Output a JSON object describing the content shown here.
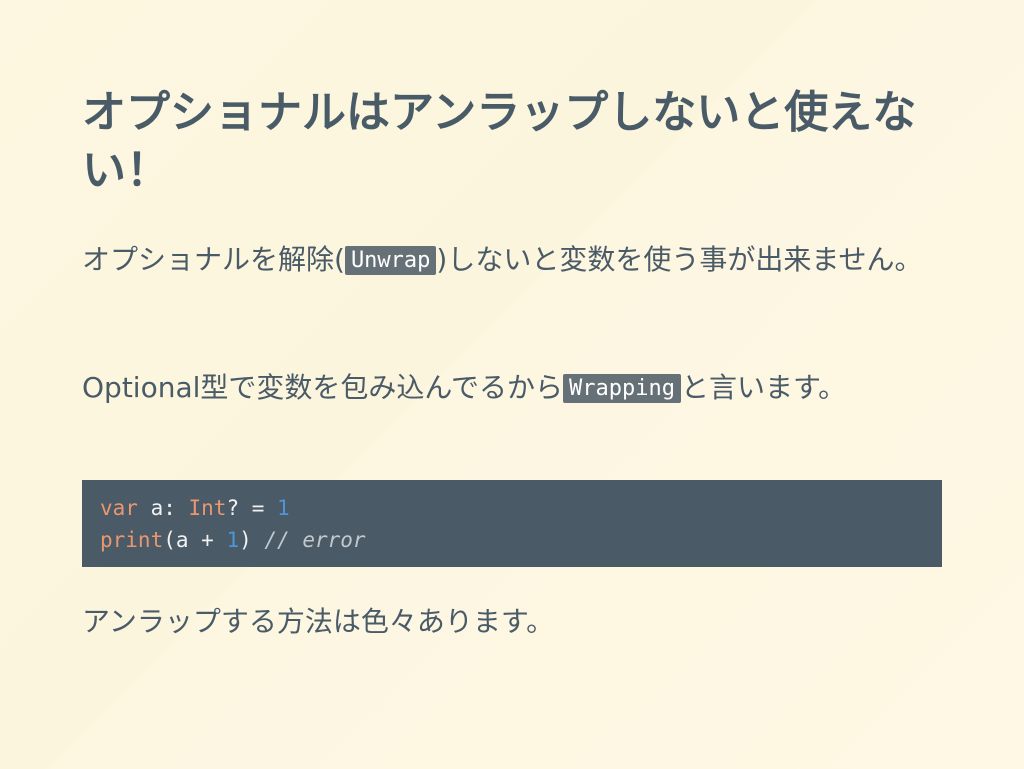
{
  "slide": {
    "title": "オプショナルはアンラップしないと使えない！",
    "paragraph1": {
      "before": "オプショナルを解除(",
      "code": "Unwrap",
      "after": ")しないと変数を使う事が出来ません。"
    },
    "paragraph2": {
      "before": "Optional型で変数を包み込んでるから",
      "code": "Wrapping",
      "after": "と言います。"
    },
    "code_block": {
      "line1": {
        "kw": "var",
        "name": " a: ",
        "type": "Int",
        "rest": "? = ",
        "num": "1"
      },
      "line2": {
        "fn": "print",
        "open": "(a + ",
        "num": "1",
        "close": ") ",
        "comment": "// error"
      }
    },
    "paragraph3": "アンラップする方法は色々あります。"
  },
  "colors": {
    "background": "#fdf7e1",
    "text": "#4a5b68",
    "code_bg": "#4a5a67",
    "keyword": "#e89770",
    "number": "#4d95d6",
    "inline_code_bg": "#667177"
  }
}
